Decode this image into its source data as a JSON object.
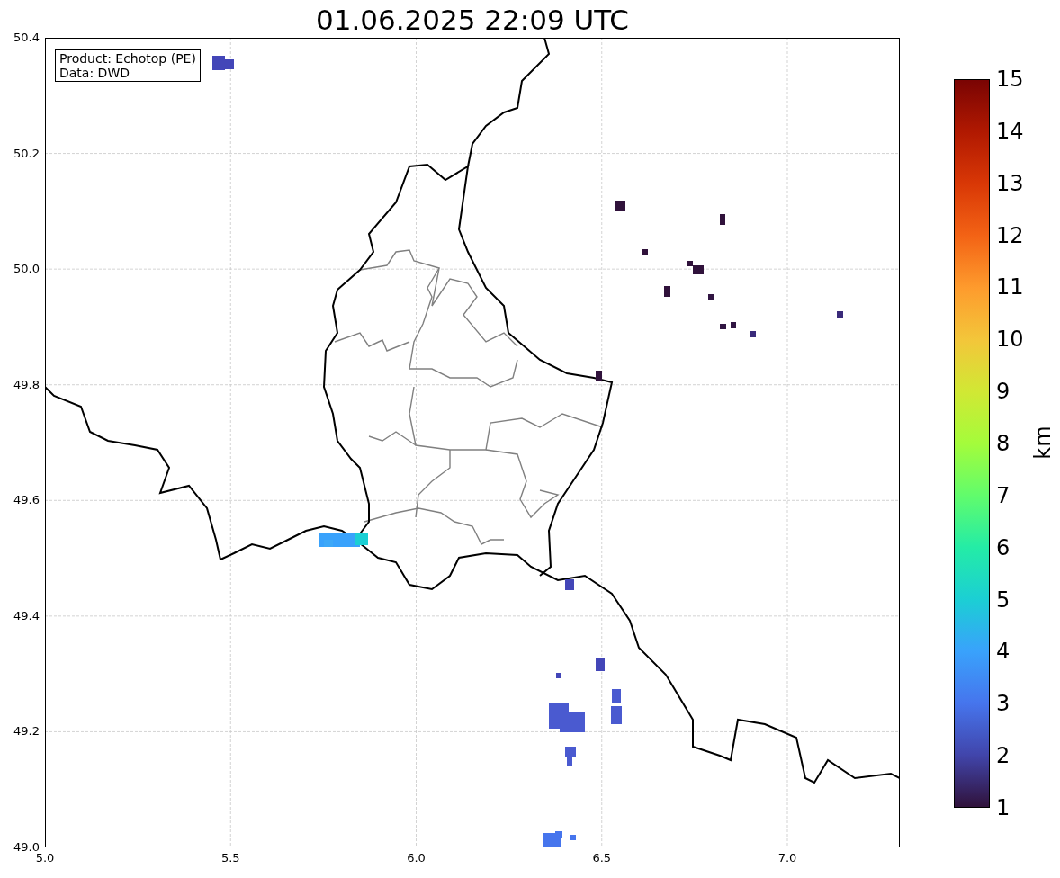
{
  "title": "01.06.2025 22:09 UTC",
  "info_box": {
    "lines": [
      "Product: Echotop (PE)",
      "Data: DWD"
    ]
  },
  "x_ticks": [
    "5.0",
    "5.5",
    "6.0",
    "6.5",
    "7.0"
  ],
  "y_ticks": [
    "50.4",
    "50.2",
    "50.0",
    "49.8",
    "49.6",
    "49.4",
    "49.2",
    "49.0"
  ],
  "colorbar": {
    "label": "km",
    "ticks": [
      "15",
      "14",
      "13",
      "12",
      "11",
      "10",
      "9",
      "8",
      "7",
      "6",
      "5",
      "4",
      "3",
      "2",
      "1"
    ]
  }
}
